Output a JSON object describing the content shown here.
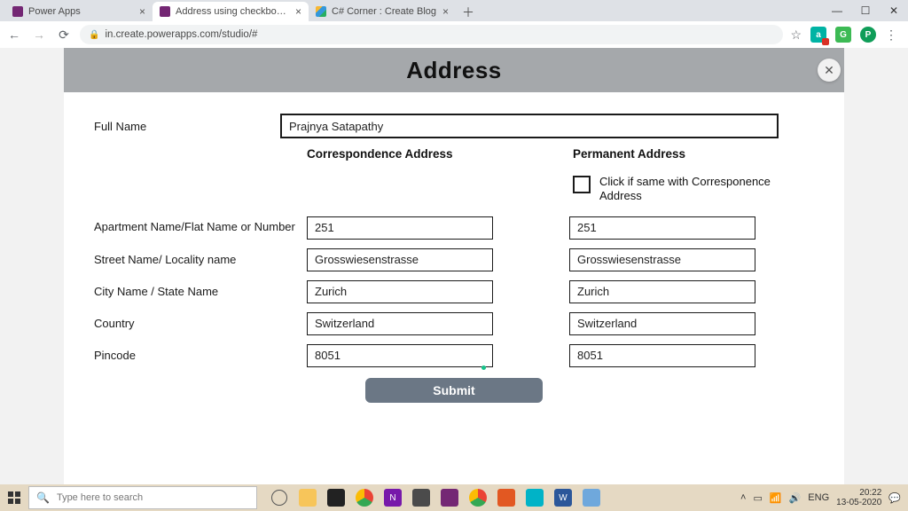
{
  "browser": {
    "tabs": [
      {
        "title": "Power Apps",
        "active": false,
        "favicon": "purple"
      },
      {
        "title": "Address using checkbox - Saved",
        "active": true,
        "favicon": "purple"
      },
      {
        "title": "C# Corner : Create Blog",
        "active": false,
        "favicon": "corner"
      }
    ],
    "url": "in.create.powerapps.com/studio/#",
    "avatar_initial": "P"
  },
  "form": {
    "title": "Address",
    "labels": {
      "full_name": "Full Name",
      "correspondence": "Correspondence Address",
      "permanent": "Permanent Address",
      "same": "Click if same with Corresponence Address",
      "apartment": "Apartment Name/Flat Name or Number",
      "street": "Street Name/ Locality name",
      "city": "City Name / State Name",
      "country": "Country",
      "pincode": "Pincode",
      "submit": "Submit"
    },
    "values": {
      "full_name": "Prajnya Satapathy",
      "c_apartment": "251",
      "c_street": "Grosswiesenstrasse",
      "c_city": "Zurich",
      "c_country": "Switzerland",
      "c_pincode": "8051",
      "p_apartment": "251",
      "p_street": "Grosswiesenstrasse",
      "p_city": "Zurich",
      "p_country": "Switzerland",
      "p_pincode": "8051"
    }
  },
  "taskbar": {
    "search_placeholder": "Type here to search",
    "lang": "ENG",
    "time": "20:22",
    "date": "13-05-2020"
  }
}
